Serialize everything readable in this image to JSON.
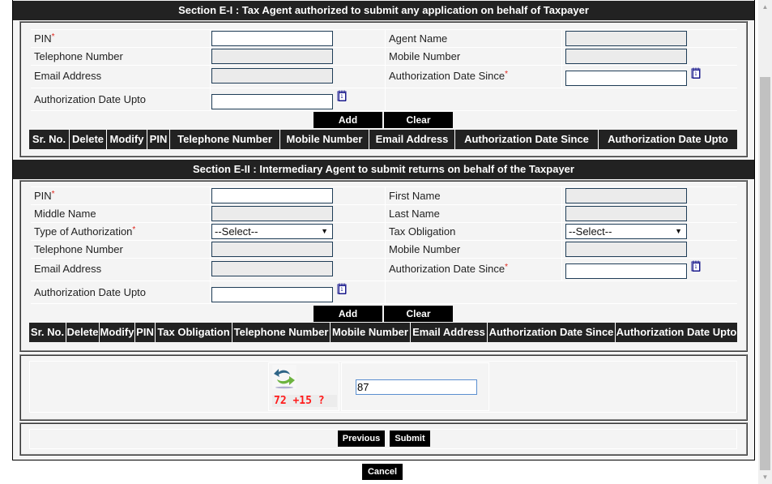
{
  "section1": {
    "title": "Section E-I : Tax Agent authorized to submit any application on behalf of Taxpayer",
    "fields": {
      "pin_label": "PIN",
      "agent_name_label": "Agent Name",
      "telephone_label": "Telephone Number",
      "mobile_label": "Mobile Number",
      "email_label": "Email Address",
      "auth_since_label": "Authorization Date Since",
      "auth_upto_label": "Authorization Date Upto"
    },
    "add_label": "Add",
    "clear_label": "Clear",
    "table_headers": [
      "Sr. No.",
      "Delete",
      "Modify",
      "PIN",
      "Telephone Number",
      "Mobile Number",
      "Email Address",
      "Authorization Date Since",
      "Authorization Date Upto"
    ]
  },
  "section2": {
    "title": "Section E-II : Intermediary Agent to submit returns on behalf of the Taxpayer",
    "fields": {
      "pin_label": "PIN",
      "first_name_label": "First Name",
      "middle_name_label": "Middle Name",
      "last_name_label": "Last Name",
      "type_auth_label": "Type of Authorization",
      "tax_obligation_label": "Tax Obligation",
      "telephone_label": "Telephone Number",
      "mobile_label": "Mobile Number",
      "email_label": "Email Address",
      "auth_since_label": "Authorization Date Since",
      "auth_upto_label": "Authorization Date Upto",
      "type_auth_value": "--Select--",
      "tax_obligation_value": "--Select--"
    },
    "add_label": "Add",
    "clear_label": "Clear",
    "table_headers": [
      "Sr. No.",
      "Delete",
      "Modify",
      "PIN",
      "Tax Obligation",
      "Telephone Number",
      "Mobile Number",
      "Email Address",
      "Authorization Date Since",
      "Authorization Date Upto"
    ]
  },
  "required_marker": "*",
  "captcha": {
    "question": "72 +15 ?",
    "answer": "87",
    "icon": "refresh-icon"
  },
  "footer": {
    "previous_label": "Previous",
    "submit_label": "Submit",
    "cancel_label": "Cancel"
  },
  "colors": {
    "header_bg": "#222222",
    "button_bg": "#000000",
    "required": "#e0251b",
    "captcha_text": "#ff1a1a"
  }
}
